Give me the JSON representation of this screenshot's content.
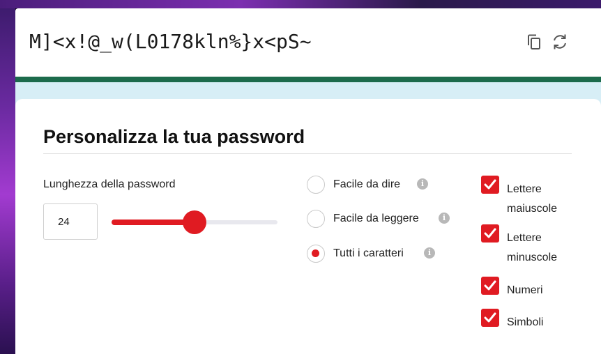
{
  "password": {
    "value": "M]<x!@_w(L0178kln%}x<pS~",
    "copy_icon": "copy-icon",
    "refresh_icon": "refresh-icon"
  },
  "customize": {
    "title": "Personalizza la tua password",
    "length_label": "Lunghezza della password",
    "length_value": "24",
    "slider_fraction": 0.5
  },
  "modes": [
    {
      "label": "Facile da dire",
      "selected": false
    },
    {
      "label": "Facile da leggere",
      "selected": false
    },
    {
      "label": "Tutti i caratteri",
      "selected": true
    }
  ],
  "info_glyph": "i",
  "options": [
    {
      "label": "Lettere maiuscole",
      "checked": true
    },
    {
      "label": "Lettere minuscole",
      "checked": true
    },
    {
      "label": "Numeri",
      "checked": true
    },
    {
      "label": "Simboli",
      "checked": true
    }
  ],
  "colors": {
    "accent": "#e01b22",
    "header_bar": "#1c6b4c",
    "band": "#d7eef6"
  }
}
